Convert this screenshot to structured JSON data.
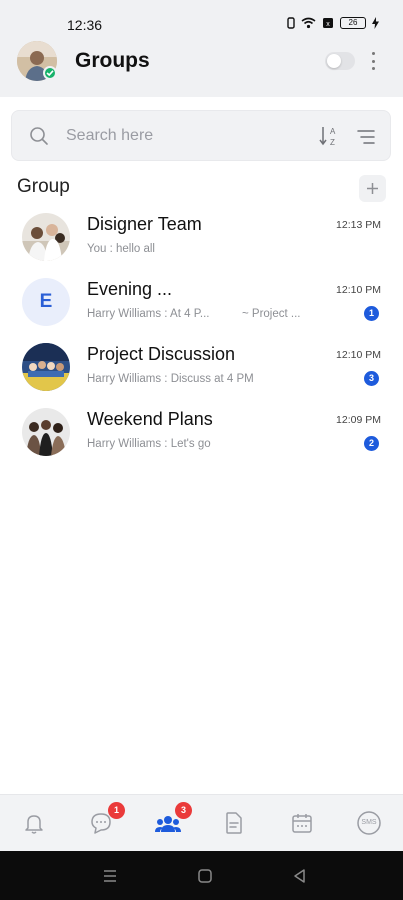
{
  "status_bar": {
    "time": "12:36",
    "battery": "26"
  },
  "header": {
    "title": "Groups"
  },
  "search": {
    "placeholder": "Search here",
    "value": ""
  },
  "section": {
    "title": "Group"
  },
  "groups": [
    {
      "name": "Disigner Team",
      "preview": "You : hello all",
      "tag": "",
      "time": "12:13 PM",
      "unread": "",
      "avatar": "photo"
    },
    {
      "name": "Evening ...",
      "preview": "Harry Williams : At 4 P...",
      "tag": "~ Project ...",
      "time": "12:10 PM",
      "unread": "1",
      "avatar": "letter",
      "letter": "E"
    },
    {
      "name": "Project Discussion",
      "preview": "Harry Williams : Discuss at 4 PM",
      "tag": "",
      "time": "12:10 PM",
      "unread": "3",
      "avatar": "photo"
    },
    {
      "name": "Weekend Plans",
      "preview": "Harry Williams : Let's go",
      "tag": "",
      "time": "12:09 PM",
      "unread": "2",
      "avatar": "photo"
    }
  ],
  "bottom_nav": [
    {
      "name": "notifications",
      "icon": "bell-icon",
      "badge": ""
    },
    {
      "name": "chats",
      "icon": "chat-icon",
      "badge": "1"
    },
    {
      "name": "groups",
      "icon": "group-icon",
      "badge": "3",
      "active": true
    },
    {
      "name": "documents",
      "icon": "document-icon",
      "badge": ""
    },
    {
      "name": "calendar",
      "icon": "calendar-icon",
      "badge": ""
    },
    {
      "name": "sms",
      "icon": "sms-icon",
      "badge": "",
      "label": "SMS"
    }
  ],
  "colors": {
    "accent": "#1e5bdc",
    "badge_red": "#ea3a3a",
    "online": "#17b26a"
  }
}
